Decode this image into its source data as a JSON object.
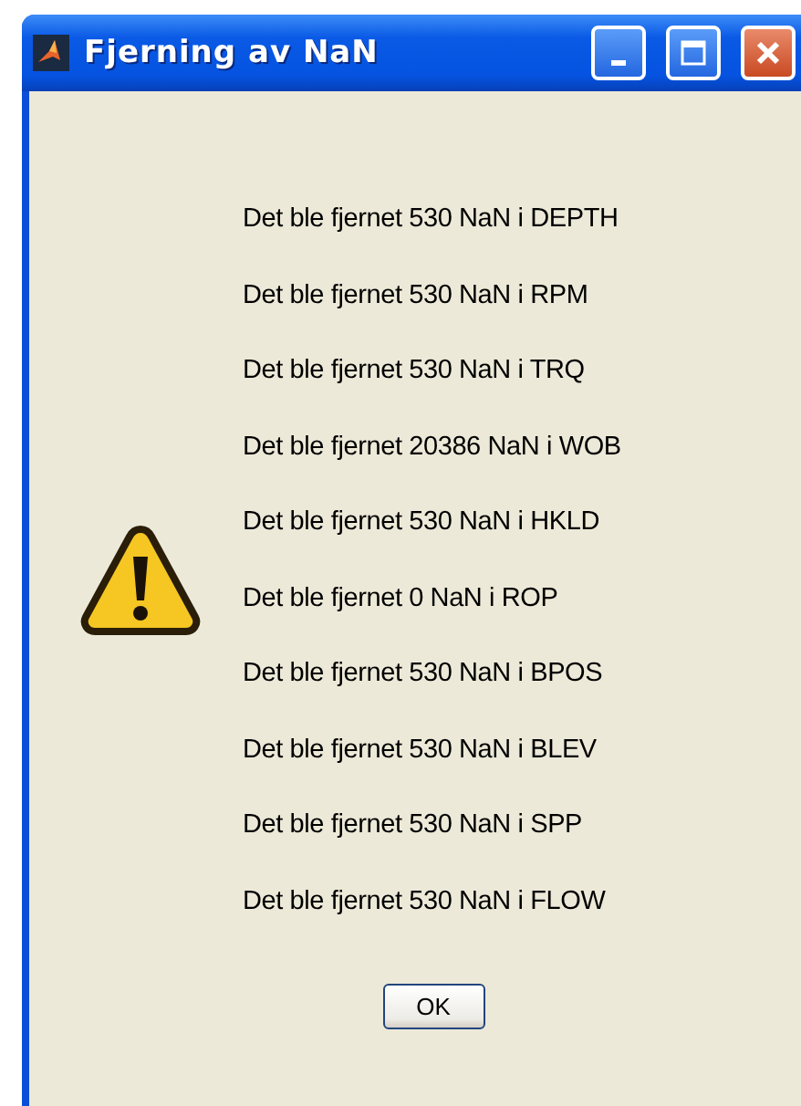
{
  "window": {
    "title": "Fjerning av NaN"
  },
  "messages": [
    "Det ble fjernet 530 NaN i DEPTH",
    "Det ble fjernet 530 NaN i RPM",
    "Det ble fjernet 530 NaN i TRQ",
    "Det ble fjernet 20386 NaN i WOB",
    "Det ble fjernet 530 NaN i HKLD",
    "Det ble fjernet 0 NaN i ROP",
    "Det ble fjernet 530 NaN i BPOS",
    "Det ble fjernet 530 NaN i BLEV",
    "Det ble fjernet 530 NaN i SPP",
    "Det ble fjernet 530 NaN i FLOW"
  ],
  "buttons": [
    "OK"
  ]
}
